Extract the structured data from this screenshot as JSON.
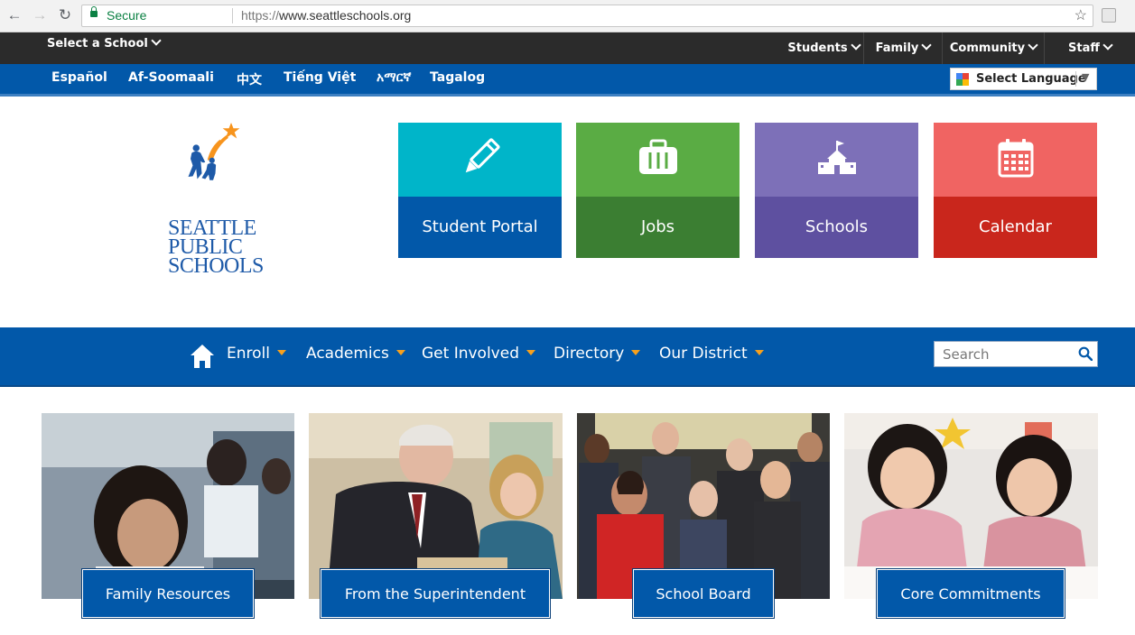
{
  "browser": {
    "secure_label": "Secure",
    "url_scheme": "https://",
    "url_host": "www.seattleschools.org"
  },
  "topbar": {
    "select_school": "Select a School",
    "nav": [
      "Students",
      "Family",
      "Community",
      "Staff"
    ]
  },
  "languages": [
    "Español",
    "Af-Soomaali",
    "中文",
    "Tiếng Việt",
    "አማርኛ",
    "Tagalog"
  ],
  "translate": {
    "label": "Select Language"
  },
  "logo": {
    "line1": "SEATTLE",
    "line2": "PUBLIC",
    "line3": "SCHOOLS"
  },
  "tiles": [
    {
      "label": "Student Portal",
      "icon": "pencil-icon",
      "top_color": "#00b5c9",
      "bottom_color": "#0258a9"
    },
    {
      "label": "Jobs",
      "icon": "briefcase-icon",
      "top_color": "#5aac44",
      "bottom_color": "#3b7e32"
    },
    {
      "label": "Schools",
      "icon": "schoolhouse-icon",
      "top_color": "#7d70b8",
      "bottom_color": "#5e50a0"
    },
    {
      "label": "Calendar",
      "icon": "calendar-icon",
      "top_color": "#f06462",
      "bottom_color": "#c9261c"
    }
  ],
  "main_nav": {
    "items": [
      "Enroll",
      "Academics",
      "Get Involved",
      "Directory",
      "Our District"
    ],
    "search_placeholder": "Search"
  },
  "cards": [
    {
      "label": "Family Resources"
    },
    {
      "label": "From the Superintendent"
    },
    {
      "label": "School Board"
    },
    {
      "label": "Core Commitments"
    }
  ]
}
